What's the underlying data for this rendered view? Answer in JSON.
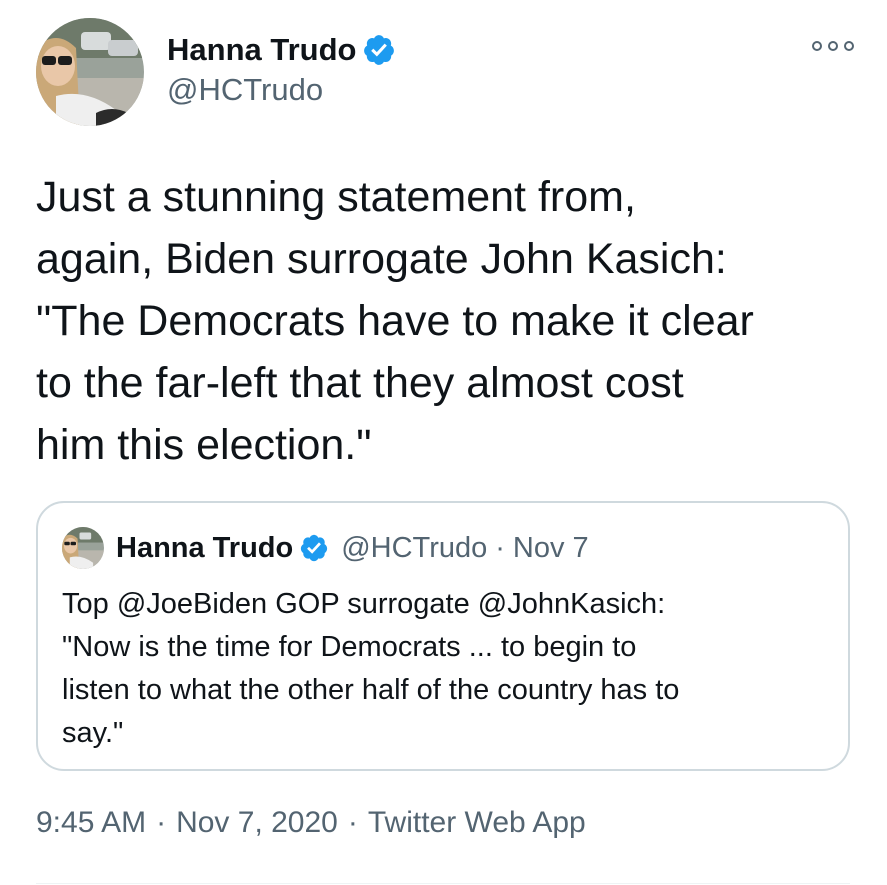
{
  "author": {
    "display_name": "Hanna Trudo",
    "handle": "@HCTrudo",
    "verified": true,
    "avatar_icon": "user-photo-avatar"
  },
  "more_icon": "more-options-icon",
  "tweet": {
    "text_lines": [
      "Just a stunning statement from,",
      "again, Biden surrogate John Kasich:",
      "\"The Democrats have to make it clear",
      "to the far-left that they almost cost",
      "him this election.\""
    ]
  },
  "quoted_tweet": {
    "display_name": "Hanna Trudo",
    "handle": "@HCTrudo",
    "separator": "·",
    "date": "Nov 7",
    "text_lines": [
      "Top @JoeBiden GOP surrogate @JohnKasich:",
      "\"Now is the time for Democrats ... to begin to",
      "listen to what the other half of the country has to",
      "say.\""
    ]
  },
  "meta": {
    "time": "9:45 AM",
    "separator": "·",
    "date": "Nov 7, 2020",
    "source": "Twitter Web App"
  },
  "colors": {
    "verified_blue": "#1d9bf0",
    "text_primary": "#0f1419",
    "text_secondary": "#536471",
    "border": "#cfd9de"
  }
}
